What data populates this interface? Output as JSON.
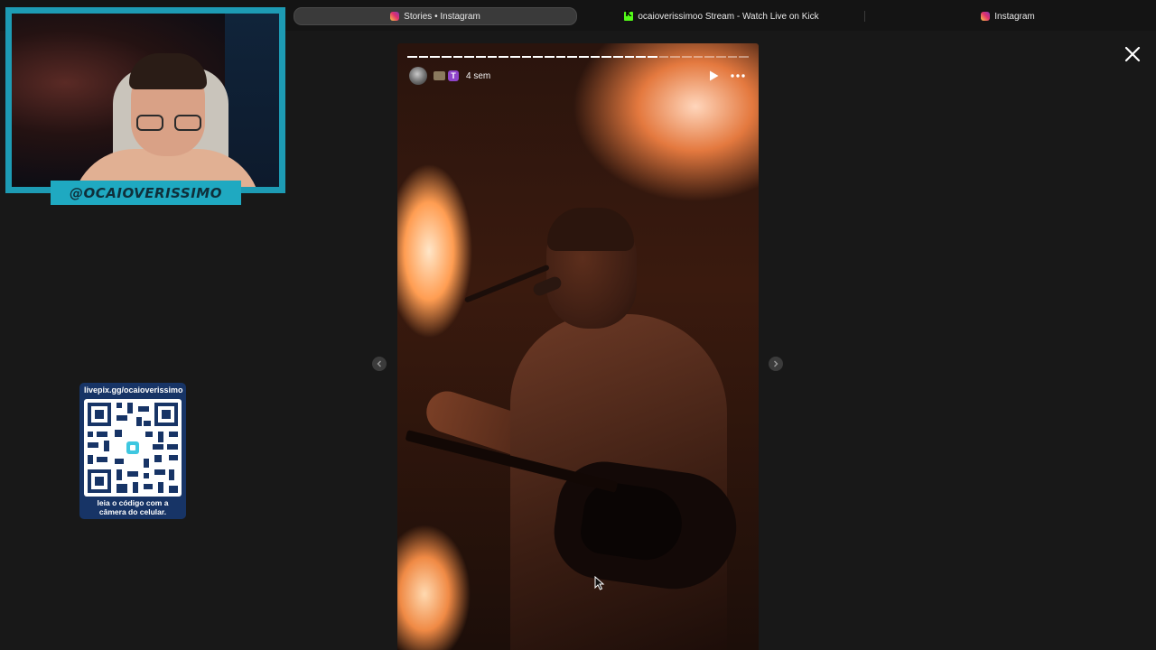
{
  "browser": {
    "tabs": [
      {
        "label": "Stories • Instagram",
        "favicon": "instagram-icon",
        "active": true
      },
      {
        "label": "ocaioverissimoo Stream - Watch Live on Kick",
        "favicon": "kick-icon",
        "active": false
      },
      {
        "label": "Instagram",
        "favicon": "instagram-icon",
        "active": false
      }
    ]
  },
  "stream_overlay": {
    "webcam_name": "@OCAIOVERISSIMO",
    "qr": {
      "url": "livepix.gg/ocaioverissimo",
      "caption_line1": "leia o código com a",
      "caption_line2": "câmera do celular."
    }
  },
  "story": {
    "posted_ago": "4 sem",
    "emoji_badge": "T",
    "progress": {
      "segments_total": 30,
      "segments_completed": 22
    },
    "controls": {
      "play_icon": "play-icon",
      "more_icon": "more-options-icon"
    }
  },
  "viewer": {
    "close_icon": "close-icon",
    "prev_icon": "chevron-left-icon",
    "next_icon": "chevron-right-icon"
  },
  "colors": {
    "overlay_accent": "#1fa9c1",
    "qr_card": "#173466",
    "background": "#181818"
  }
}
